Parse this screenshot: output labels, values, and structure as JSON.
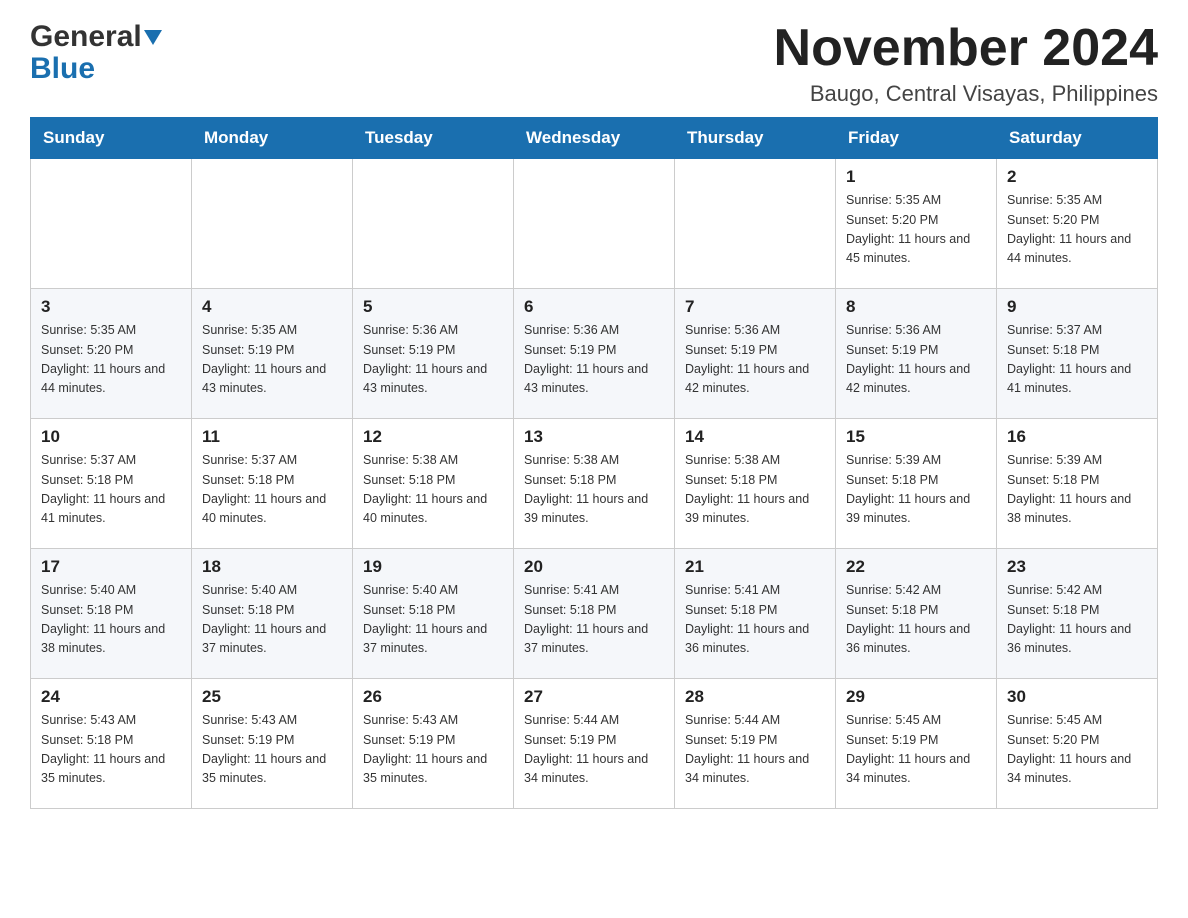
{
  "header": {
    "logo_general": "General",
    "logo_blue": "Blue",
    "month_title": "November 2024",
    "location": "Baugo, Central Visayas, Philippines"
  },
  "days_of_week": [
    "Sunday",
    "Monday",
    "Tuesday",
    "Wednesday",
    "Thursday",
    "Friday",
    "Saturday"
  ],
  "weeks": [
    [
      {
        "day": "",
        "sunrise": "",
        "sunset": "",
        "daylight": ""
      },
      {
        "day": "",
        "sunrise": "",
        "sunset": "",
        "daylight": ""
      },
      {
        "day": "",
        "sunrise": "",
        "sunset": "",
        "daylight": ""
      },
      {
        "day": "",
        "sunrise": "",
        "sunset": "",
        "daylight": ""
      },
      {
        "day": "",
        "sunrise": "",
        "sunset": "",
        "daylight": ""
      },
      {
        "day": "1",
        "sunrise": "Sunrise: 5:35 AM",
        "sunset": "Sunset: 5:20 PM",
        "daylight": "Daylight: 11 hours and 45 minutes."
      },
      {
        "day": "2",
        "sunrise": "Sunrise: 5:35 AM",
        "sunset": "Sunset: 5:20 PM",
        "daylight": "Daylight: 11 hours and 44 minutes."
      }
    ],
    [
      {
        "day": "3",
        "sunrise": "Sunrise: 5:35 AM",
        "sunset": "Sunset: 5:20 PM",
        "daylight": "Daylight: 11 hours and 44 minutes."
      },
      {
        "day": "4",
        "sunrise": "Sunrise: 5:35 AM",
        "sunset": "Sunset: 5:19 PM",
        "daylight": "Daylight: 11 hours and 43 minutes."
      },
      {
        "day": "5",
        "sunrise": "Sunrise: 5:36 AM",
        "sunset": "Sunset: 5:19 PM",
        "daylight": "Daylight: 11 hours and 43 minutes."
      },
      {
        "day": "6",
        "sunrise": "Sunrise: 5:36 AM",
        "sunset": "Sunset: 5:19 PM",
        "daylight": "Daylight: 11 hours and 43 minutes."
      },
      {
        "day": "7",
        "sunrise": "Sunrise: 5:36 AM",
        "sunset": "Sunset: 5:19 PM",
        "daylight": "Daylight: 11 hours and 42 minutes."
      },
      {
        "day": "8",
        "sunrise": "Sunrise: 5:36 AM",
        "sunset": "Sunset: 5:19 PM",
        "daylight": "Daylight: 11 hours and 42 minutes."
      },
      {
        "day": "9",
        "sunrise": "Sunrise: 5:37 AM",
        "sunset": "Sunset: 5:18 PM",
        "daylight": "Daylight: 11 hours and 41 minutes."
      }
    ],
    [
      {
        "day": "10",
        "sunrise": "Sunrise: 5:37 AM",
        "sunset": "Sunset: 5:18 PM",
        "daylight": "Daylight: 11 hours and 41 minutes."
      },
      {
        "day": "11",
        "sunrise": "Sunrise: 5:37 AM",
        "sunset": "Sunset: 5:18 PM",
        "daylight": "Daylight: 11 hours and 40 minutes."
      },
      {
        "day": "12",
        "sunrise": "Sunrise: 5:38 AM",
        "sunset": "Sunset: 5:18 PM",
        "daylight": "Daylight: 11 hours and 40 minutes."
      },
      {
        "day": "13",
        "sunrise": "Sunrise: 5:38 AM",
        "sunset": "Sunset: 5:18 PM",
        "daylight": "Daylight: 11 hours and 39 minutes."
      },
      {
        "day": "14",
        "sunrise": "Sunrise: 5:38 AM",
        "sunset": "Sunset: 5:18 PM",
        "daylight": "Daylight: 11 hours and 39 minutes."
      },
      {
        "day": "15",
        "sunrise": "Sunrise: 5:39 AM",
        "sunset": "Sunset: 5:18 PM",
        "daylight": "Daylight: 11 hours and 39 minutes."
      },
      {
        "day": "16",
        "sunrise": "Sunrise: 5:39 AM",
        "sunset": "Sunset: 5:18 PM",
        "daylight": "Daylight: 11 hours and 38 minutes."
      }
    ],
    [
      {
        "day": "17",
        "sunrise": "Sunrise: 5:40 AM",
        "sunset": "Sunset: 5:18 PM",
        "daylight": "Daylight: 11 hours and 38 minutes."
      },
      {
        "day": "18",
        "sunrise": "Sunrise: 5:40 AM",
        "sunset": "Sunset: 5:18 PM",
        "daylight": "Daylight: 11 hours and 37 minutes."
      },
      {
        "day": "19",
        "sunrise": "Sunrise: 5:40 AM",
        "sunset": "Sunset: 5:18 PM",
        "daylight": "Daylight: 11 hours and 37 minutes."
      },
      {
        "day": "20",
        "sunrise": "Sunrise: 5:41 AM",
        "sunset": "Sunset: 5:18 PM",
        "daylight": "Daylight: 11 hours and 37 minutes."
      },
      {
        "day": "21",
        "sunrise": "Sunrise: 5:41 AM",
        "sunset": "Sunset: 5:18 PM",
        "daylight": "Daylight: 11 hours and 36 minutes."
      },
      {
        "day": "22",
        "sunrise": "Sunrise: 5:42 AM",
        "sunset": "Sunset: 5:18 PM",
        "daylight": "Daylight: 11 hours and 36 minutes."
      },
      {
        "day": "23",
        "sunrise": "Sunrise: 5:42 AM",
        "sunset": "Sunset: 5:18 PM",
        "daylight": "Daylight: 11 hours and 36 minutes."
      }
    ],
    [
      {
        "day": "24",
        "sunrise": "Sunrise: 5:43 AM",
        "sunset": "Sunset: 5:18 PM",
        "daylight": "Daylight: 11 hours and 35 minutes."
      },
      {
        "day": "25",
        "sunrise": "Sunrise: 5:43 AM",
        "sunset": "Sunset: 5:19 PM",
        "daylight": "Daylight: 11 hours and 35 minutes."
      },
      {
        "day": "26",
        "sunrise": "Sunrise: 5:43 AM",
        "sunset": "Sunset: 5:19 PM",
        "daylight": "Daylight: 11 hours and 35 minutes."
      },
      {
        "day": "27",
        "sunrise": "Sunrise: 5:44 AM",
        "sunset": "Sunset: 5:19 PM",
        "daylight": "Daylight: 11 hours and 34 minutes."
      },
      {
        "day": "28",
        "sunrise": "Sunrise: 5:44 AM",
        "sunset": "Sunset: 5:19 PM",
        "daylight": "Daylight: 11 hours and 34 minutes."
      },
      {
        "day": "29",
        "sunrise": "Sunrise: 5:45 AM",
        "sunset": "Sunset: 5:19 PM",
        "daylight": "Daylight: 11 hours and 34 minutes."
      },
      {
        "day": "30",
        "sunrise": "Sunrise: 5:45 AM",
        "sunset": "Sunset: 5:20 PM",
        "daylight": "Daylight: 11 hours and 34 minutes."
      }
    ]
  ]
}
